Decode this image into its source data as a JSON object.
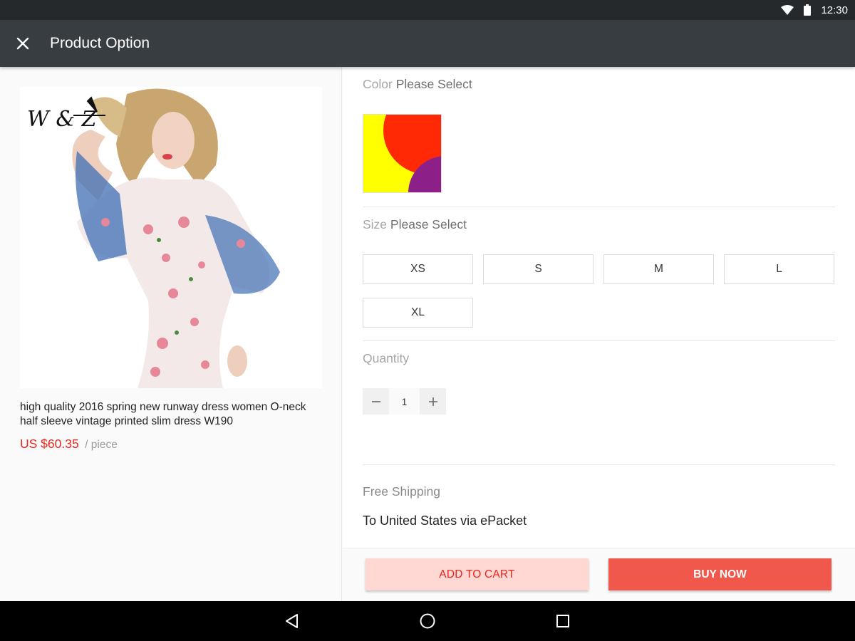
{
  "status_bar": {
    "time": "12:30",
    "icons": [
      "wifi-icon",
      "battery-icon"
    ]
  },
  "toolbar": {
    "title": "Product Option",
    "close_icon": "close-icon"
  },
  "product": {
    "image_logo": "W & Z",
    "title": "high quality 2016 spring new runway dress women O-neck half sleeve vintage printed slim dress W190",
    "price": "US $60.35",
    "unit": "/ piece"
  },
  "options": {
    "color": {
      "label": "Color",
      "selection": "Please Select",
      "swatch_colors": {
        "yellow": "#ffff00",
        "red": "#ff2a05",
        "purple": "#8d2088"
      }
    },
    "size": {
      "label": "Size",
      "selection": "Please Select",
      "items": [
        "XS",
        "S",
        "M",
        "L",
        "XL"
      ]
    },
    "quantity": {
      "label": "Quantity",
      "value": "1",
      "minus": "−",
      "plus": "+"
    }
  },
  "shipping": {
    "title": "Free Shipping",
    "detail": "To United States via ePacket"
  },
  "actions": {
    "add_to_cart": "ADD TO CART",
    "buy_now": "BUY NOW"
  },
  "nav": [
    "back-icon",
    "home-icon",
    "recents-icon"
  ],
  "colors": {
    "accent": "#e8261c",
    "buy_now": "#ef584b",
    "add_cart_bg": "#ffd8d4",
    "toolbar": "#383d41"
  }
}
